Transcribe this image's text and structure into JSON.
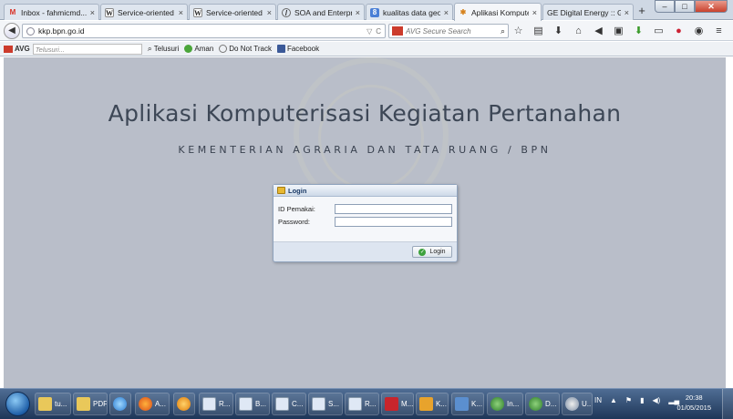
{
  "browser": {
    "tabs": [
      {
        "label": "Inbox - fahmicmd...",
        "icon": "gmail-icon",
        "active": false
      },
      {
        "label": "Service-oriented ar...",
        "icon": "wikipedia-icon",
        "active": false
      },
      {
        "label": "Service-oriented ar...",
        "icon": "wikipedia-icon",
        "active": false
      },
      {
        "label": "SOA and Enterpris...",
        "icon": "site-icon",
        "active": false
      },
      {
        "label": "kualitas data geok...",
        "icon": "google-scholar-icon",
        "active": false
      },
      {
        "label": "Aplikasi Komputeri...",
        "icon": "bpn-icon",
        "active": true
      },
      {
        "label": "GE Digital Energy :: Ge...",
        "icon": "blank-icon",
        "active": false
      }
    ],
    "url": "kkp.bpn.go.id",
    "search_placeholder": "AVG Secure Search",
    "window_controls": {
      "minimize": "–",
      "maximize": "□",
      "close": "✕"
    }
  },
  "toolbar": {
    "brand": "AVG",
    "search_placeholder": "Telusuri...",
    "items": [
      "Telusuri",
      "Aman",
      "Do Not Track",
      "Facebook"
    ]
  },
  "page": {
    "title": "Aplikasi Komputerisasi Kegiatan Pertanahan",
    "subtitle": "KEMENTERIAN AGRARIA DAN TATA RUANG / BPN",
    "login": {
      "header": "Login",
      "id_label": "ID Pemakai:",
      "id_value": "",
      "password_label": "Password:",
      "password_value": "",
      "button": "Login"
    }
  },
  "taskbar": {
    "buttons": [
      {
        "label": "tu...",
        "icon": "folder-icon"
      },
      {
        "label": "PDF",
        "icon": "folder-icon"
      },
      {
        "label": "",
        "icon": "ie-icon"
      },
      {
        "label": "A...",
        "icon": "firefox-icon"
      },
      {
        "label": "",
        "icon": "orange-app-icon"
      },
      {
        "label": "R...",
        "icon": "word-icon"
      },
      {
        "label": "B...",
        "icon": "word-icon"
      },
      {
        "label": "C...",
        "icon": "word-icon"
      },
      {
        "label": "S...",
        "icon": "word-icon"
      },
      {
        "label": "R...",
        "icon": "word-icon"
      },
      {
        "label": "M...",
        "icon": "mendeley-icon"
      },
      {
        "label": "K...",
        "icon": "pdf-icon"
      },
      {
        "label": "K...",
        "icon": "window-icon"
      },
      {
        "label": "In...",
        "icon": "network-icon"
      },
      {
        "label": "D...",
        "icon": "network-icon"
      },
      {
        "label": "U...",
        "icon": "disc-icon"
      }
    ],
    "tray": {
      "lang": "IN"
    },
    "clock": {
      "time": "20:38",
      "date": "01/05/2015"
    }
  }
}
